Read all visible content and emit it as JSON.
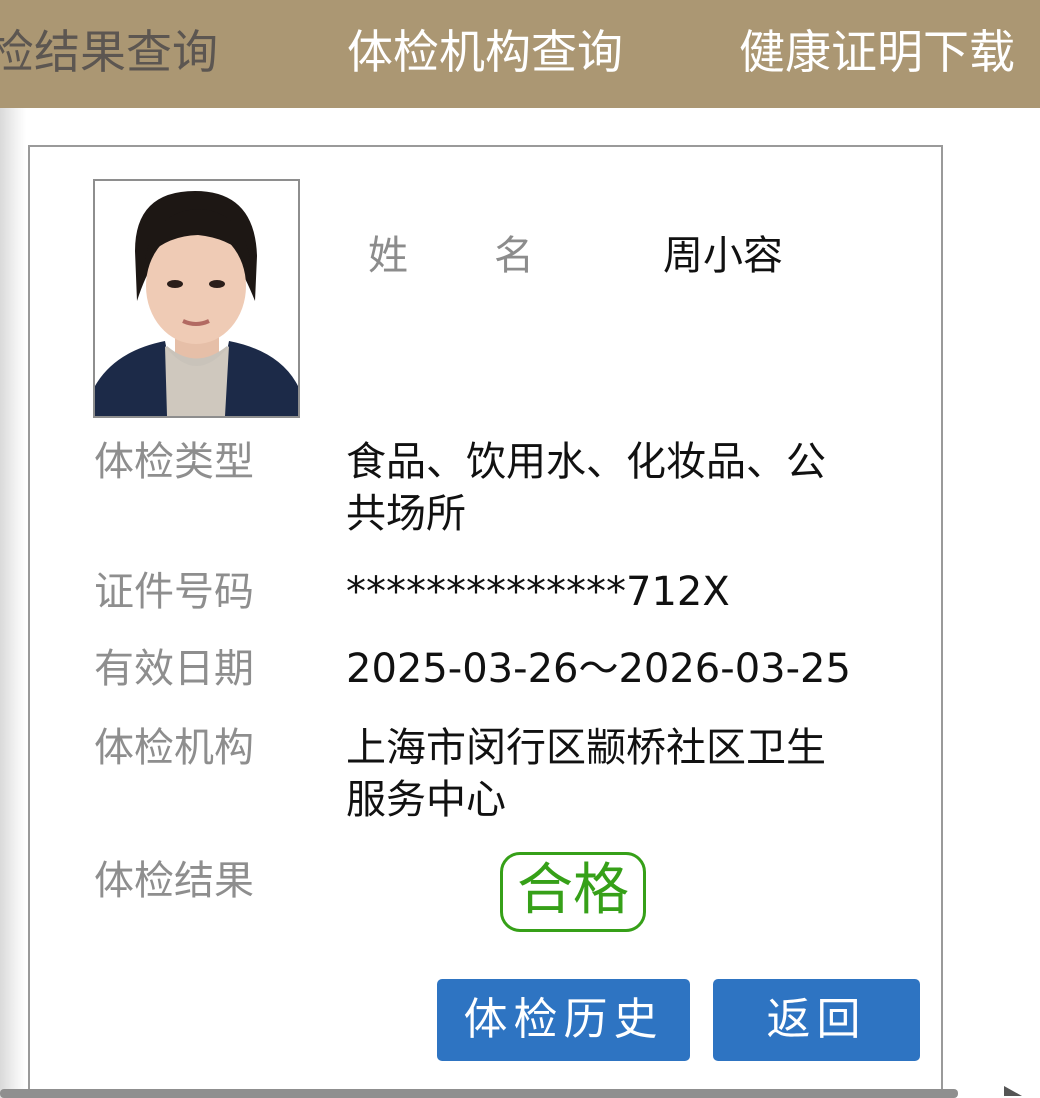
{
  "nav": {
    "tabs": [
      {
        "label": "检结果查询"
      },
      {
        "label": "体检机构查询"
      },
      {
        "label": "健康证明下载"
      }
    ]
  },
  "profile": {
    "name_label_1": "姓",
    "name_label_2": "名",
    "name": "周小容"
  },
  "fields": {
    "exam_type_label": "体检类型",
    "exam_type_value": "食品、饮用水、化妆品、公共场所",
    "id_label": "证件号码",
    "id_value": "**************712X",
    "validity_label": "有效日期",
    "validity_value": "2025-03-26～2026-03-25",
    "institution_label": "体检机构",
    "institution_value": "上海市闵行区颛桥社区卫生服务中心",
    "result_label": "体检结果",
    "result_value": "合格"
  },
  "buttons": {
    "history": "体检历史",
    "back": "返回"
  },
  "colors": {
    "nav_bg": "#ab9773",
    "button_bg": "#2e74c2",
    "pass_green": "#36a018"
  }
}
